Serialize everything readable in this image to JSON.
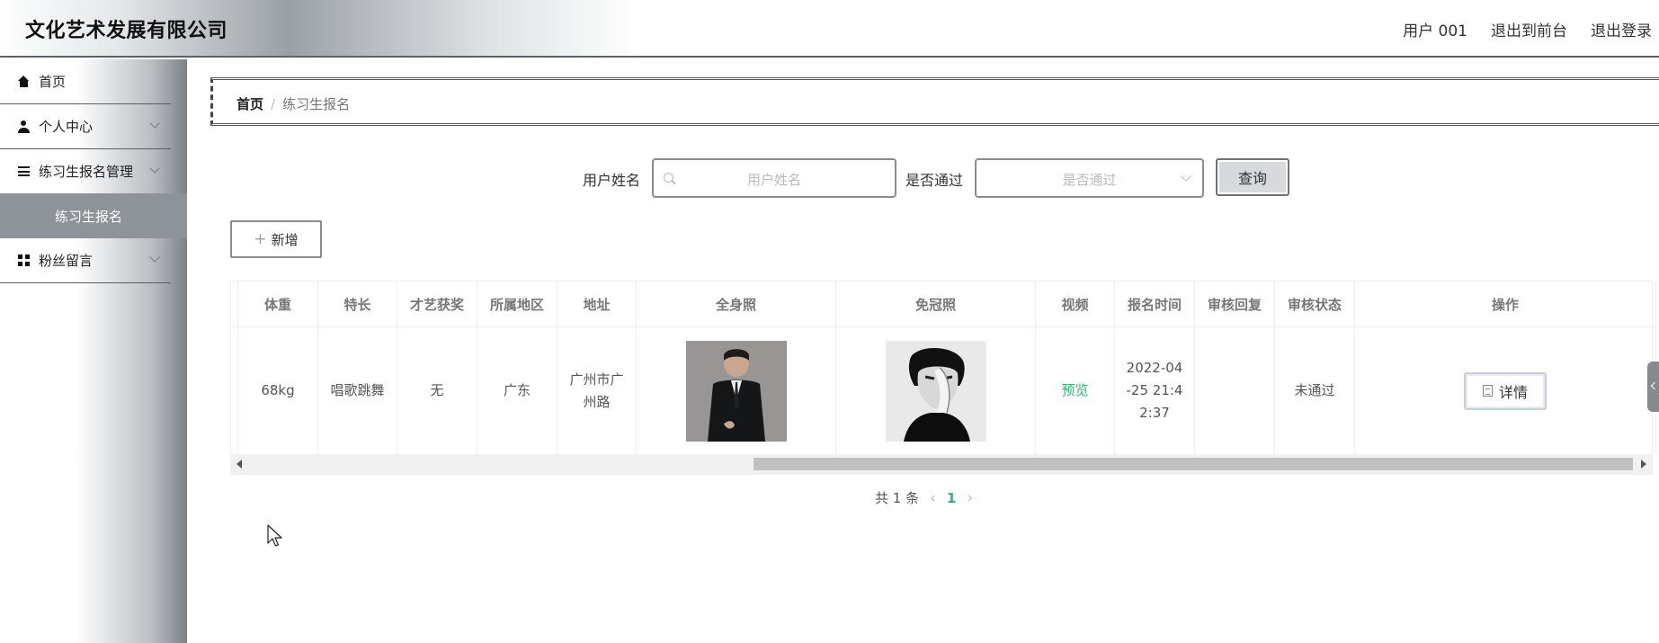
{
  "header": {
    "brand": "文化艺术发展有限公司",
    "links": [
      "用户 001",
      "退出到前台",
      "退出登录"
    ]
  },
  "sidebar": {
    "items": [
      {
        "label": "首页",
        "icon": "home-icon"
      },
      {
        "label": "个人中心",
        "icon": "user-icon"
      },
      {
        "label": "练习生报名管理",
        "icon": "list-icon"
      },
      {
        "label": "粉丝留言",
        "icon": "grid-icon"
      }
    ],
    "sub_item": "练习生报名"
  },
  "breadcrumb": {
    "home": "首页",
    "separator": "/",
    "current": "练习生报名"
  },
  "search": {
    "username_label": "用户姓名",
    "username_placeholder": "用户姓名",
    "pass_label": "是否通过",
    "pass_placeholder": "是否通过",
    "query_button": "查询"
  },
  "add_button": "新增",
  "table": {
    "headers": [
      "体重",
      "特长",
      "才艺获奖",
      "所属地区",
      "地址",
      "全身照",
      "免冠照",
      "视频",
      "报名时间",
      "审核回复",
      "审核状态",
      "操作"
    ],
    "row": {
      "weight": "68kg",
      "specialty": "唱歌跳舞",
      "award": "无",
      "region": "广东",
      "address": "广州市广州路",
      "video": "预览",
      "signup_time": "2022-04-25 21:42:37",
      "audit_reply": "",
      "audit_status": "未通过",
      "action": "详情"
    }
  },
  "pagination": {
    "total": "共 1 条",
    "current_page": "1"
  },
  "colors": {
    "accent_green": "#2bb573",
    "sidebar_active": "#8e9399"
  }
}
